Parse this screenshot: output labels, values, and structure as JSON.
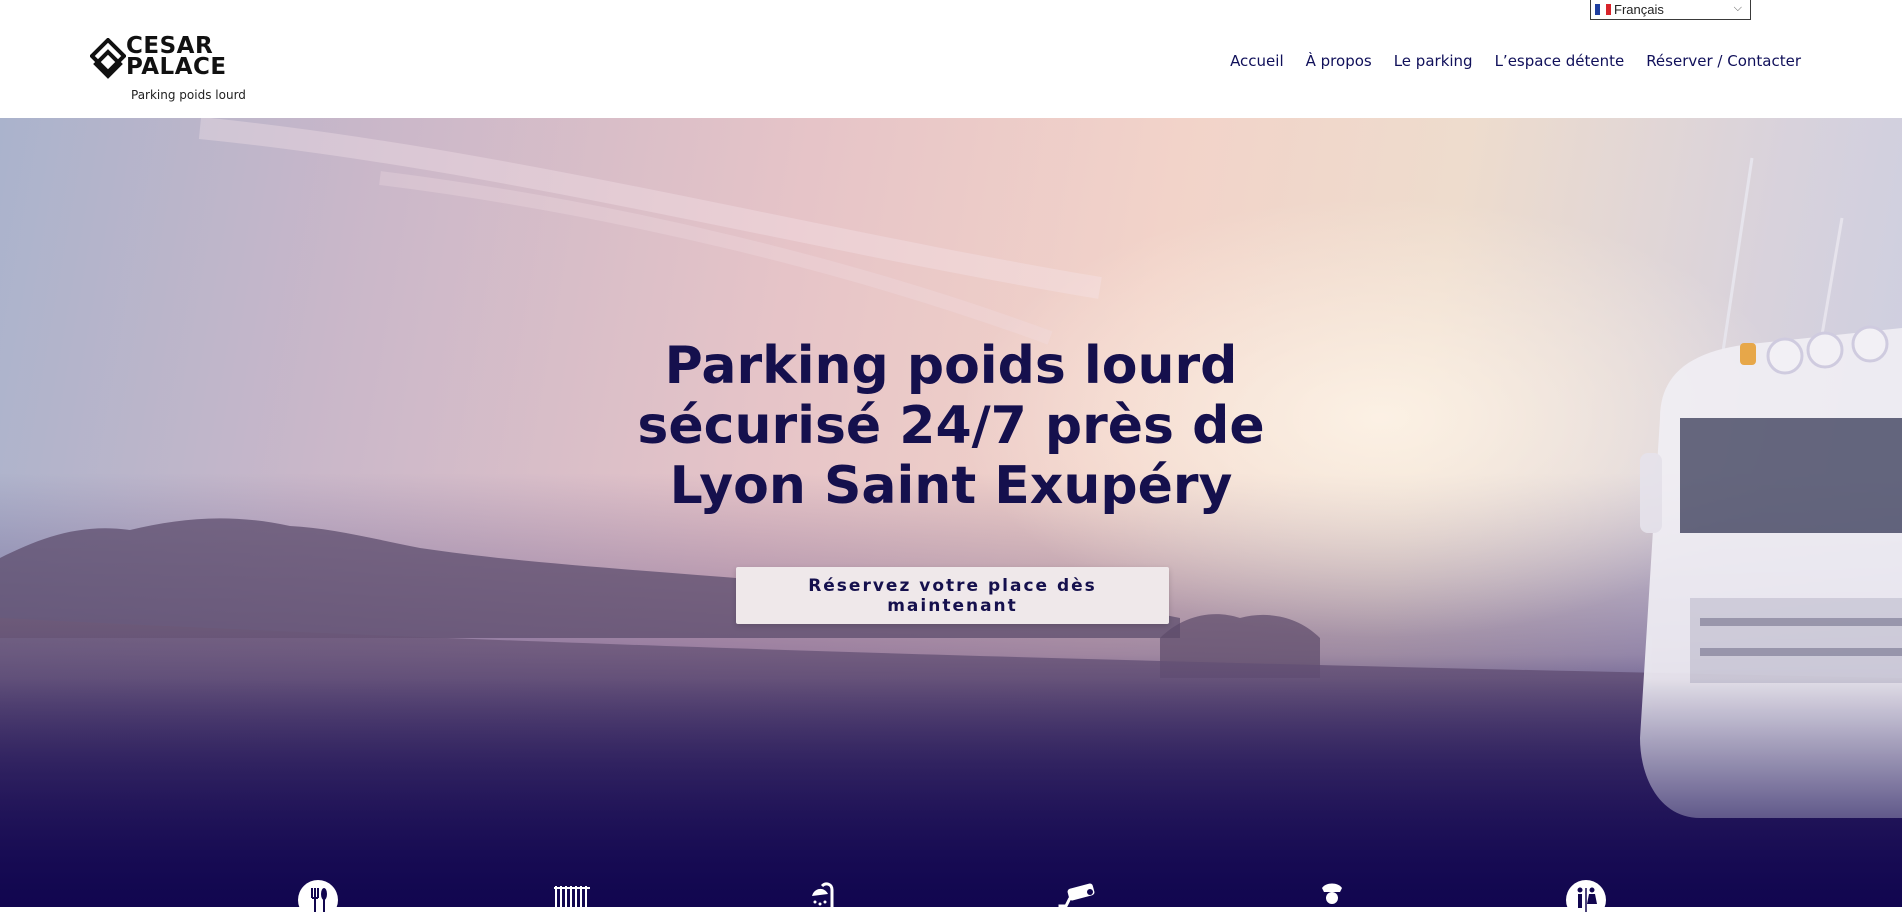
{
  "header": {
    "logo": {
      "line1": "CESAR",
      "line2": "PALACE",
      "tagline": "Parking poids lourd",
      "icon": "diamond-logo-icon"
    },
    "language": {
      "selected": "Français",
      "flag": "france-flag-icon"
    },
    "nav": [
      {
        "label": "Accueil"
      },
      {
        "label": "À propos"
      },
      {
        "label": "Le parking"
      },
      {
        "label": "L’espace détente"
      },
      {
        "label": "Réserver / Contacter"
      }
    ]
  },
  "hero": {
    "title_lines": [
      "Parking poids lourd",
      "sécurisé 24/7 près de",
      "Lyon Saint Exupéry"
    ],
    "cta_label": "Réservez votre place dès maintenant"
  },
  "services": [
    {
      "icon": "restaurant-icon"
    },
    {
      "icon": "gate-icon"
    },
    {
      "icon": "shower-icon"
    },
    {
      "icon": "security-camera-icon"
    },
    {
      "icon": "security-guard-icon"
    },
    {
      "icon": "toilets-icon"
    }
  ],
  "colors": {
    "navy": "#15104d",
    "nav_text": "#10105a",
    "hero_bottom": "#11064f",
    "cta_bg": "#efe8ea"
  }
}
